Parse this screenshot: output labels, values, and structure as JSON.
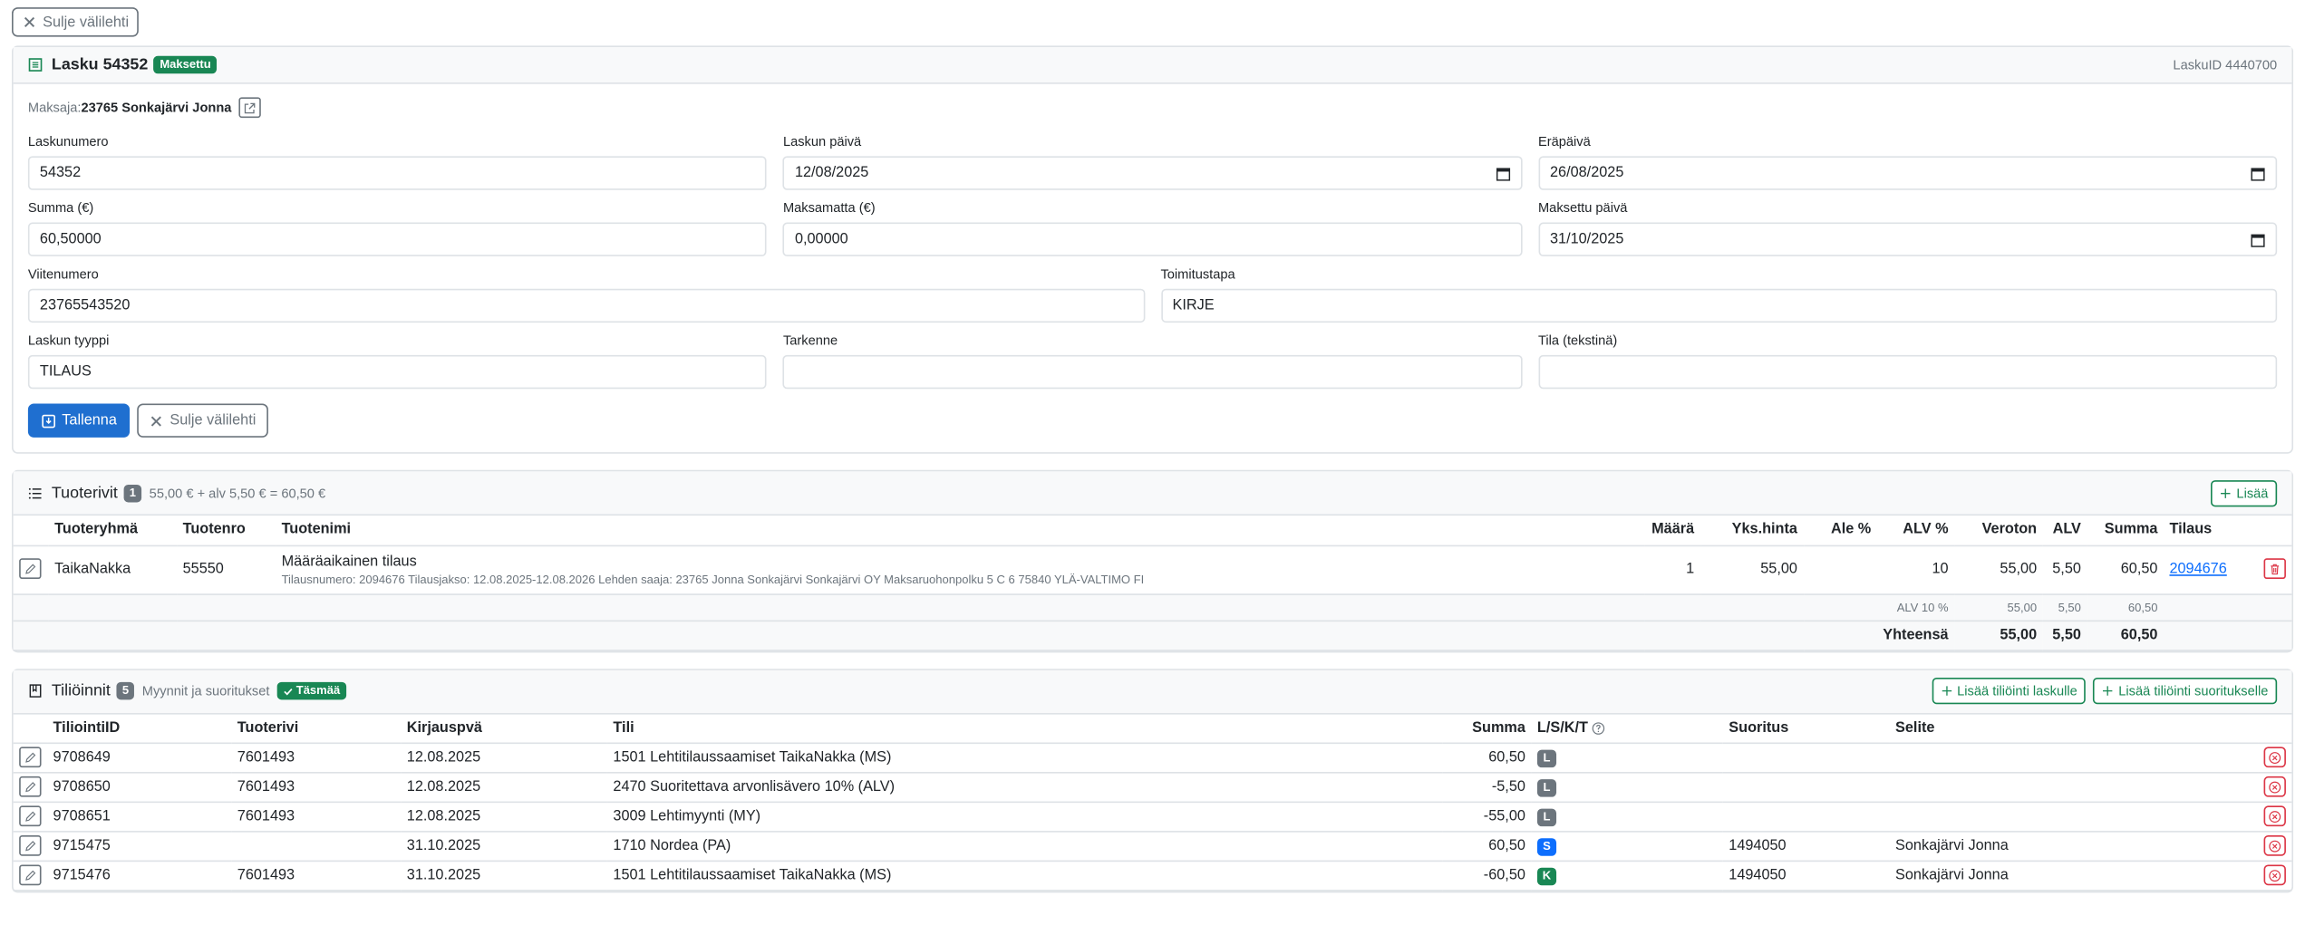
{
  "top": {
    "close_tab_label": "Sulje välilehti"
  },
  "invoice": {
    "title": "Lasku 54352",
    "status_badge": "Maksettu",
    "lasku_id": "LaskuID 4440700",
    "payer_label": "Maksaja:",
    "payer_value": "23765 Sonkajärvi Jonna",
    "fields": {
      "laskunumero": {
        "label": "Laskunumero",
        "value": "54352"
      },
      "laskun_paiva": {
        "label": "Laskun päivä",
        "value": "12/08/2025"
      },
      "erapaiva": {
        "label": "Eräpäivä",
        "value": "26/08/2025"
      },
      "summa": {
        "label": "Summa (€)",
        "value": "60,50000"
      },
      "maksamatta": {
        "label": "Maksamatta (€)",
        "value": "0,00000"
      },
      "maksettu_paiva": {
        "label": "Maksettu päivä",
        "value": "31/10/2025"
      },
      "viitenumero": {
        "label": "Viitenumero",
        "value": "23765543520"
      },
      "toimitustapa": {
        "label": "Toimitustapa",
        "value": "KIRJE"
      },
      "laskun_tyyppi": {
        "label": "Laskun tyyppi",
        "value": "TILAUS"
      },
      "tarkenne": {
        "label": "Tarkenne",
        "value": ""
      },
      "tila": {
        "label": "Tila (tekstinä)",
        "value": ""
      }
    },
    "save_label": "Tallenna",
    "close_label": "Sulje välilehti"
  },
  "products": {
    "title": "Tuoterivit",
    "count": "1",
    "summary": "55,00 € + alv 5,50 € = 60,50 €",
    "add_label": "Lisää",
    "headers": {
      "group": "Tuoteryhmä",
      "number": "Tuotenro",
      "name": "Tuotenimi",
      "qty": "Määrä",
      "unit_price": "Yks.hinta",
      "discount": "Ale %",
      "vat_pct": "ALV %",
      "net": "Veroton",
      "vat": "ALV",
      "sum": "Summa",
      "order": "Tilaus"
    },
    "row": {
      "group": "TaikaNakka",
      "number": "55550",
      "name": "Määräaikainen tilaus",
      "desc": "Tilausnumero: 2094676 Tilausjakso: 12.08.2025-12.08.2026 Lehden saaja: 23765 Jonna Sonkajärvi Sonkajärvi OY Maksaruohonpolku 5 C 6 75840 YLÄ-VALTIMO FI",
      "qty": "1",
      "unit_price": "55,00",
      "discount": "",
      "vat_pct": "10",
      "net": "55,00",
      "vat": "5,50",
      "sum": "60,50",
      "order": "2094676"
    },
    "vat_row": {
      "label": "ALV 10 %",
      "net": "55,00",
      "vat": "5,50",
      "sum": "60,50"
    },
    "total_row": {
      "label": "Yhteensä",
      "net": "55,00",
      "vat": "5,50",
      "sum": "60,50"
    }
  },
  "postings": {
    "title": "Tiliöinnit",
    "count": "5",
    "subtitle": "Myynnit ja suoritukset",
    "match_badge": "Täsmää",
    "add_invoice_label": "Lisää tiliöinti laskulle",
    "add_payment_label": "Lisää tiliöinti suoritukselle",
    "headers": {
      "id": "TiliointiID",
      "product_row": "Tuoterivi",
      "date": "Kirjauspvä",
      "account": "Tili",
      "sum": "Summa",
      "lskt": "L/S/K/T",
      "payment": "Suoritus",
      "desc": "Selite"
    },
    "rows": [
      {
        "id": "9708649",
        "product_row": "7601493",
        "date": "12.08.2025",
        "account": "1501 Lehtitilaussaamiset TaikaNakka (MS)",
        "sum": "60,50",
        "type": "L",
        "type_color": "#6c757d",
        "payment": "",
        "desc": ""
      },
      {
        "id": "9708650",
        "product_row": "7601493",
        "date": "12.08.2025",
        "account": "2470 Suoritettava arvonlisävero 10% (ALV)",
        "sum": "-5,50",
        "type": "L",
        "type_color": "#6c757d",
        "payment": "",
        "desc": ""
      },
      {
        "id": "9708651",
        "product_row": "7601493",
        "date": "12.08.2025",
        "account": "3009 Lehtimyynti (MY)",
        "sum": "-55,00",
        "type": "L",
        "type_color": "#6c757d",
        "payment": "",
        "desc": ""
      },
      {
        "id": "9715475",
        "product_row": "",
        "date": "31.10.2025",
        "account": "1710 Nordea (PA)",
        "sum": "60,50",
        "type": "S",
        "type_color": "#0d6efd",
        "payment": "1494050",
        "desc": "Sonkajärvi Jonna"
      },
      {
        "id": "9715476",
        "product_row": "7601493",
        "date": "31.10.2025",
        "account": "1501 Lehtitilaussaamiset TaikaNakka (MS)",
        "sum": "-60,50",
        "type": "K",
        "type_color": "#198754",
        "payment": "1494050",
        "desc": "Sonkajärvi Jonna"
      }
    ]
  },
  "icons": {
    "close": "x-icon",
    "invoice": "receipt-icon",
    "external": "external-link-icon",
    "calendar": "calendar-icon",
    "save": "save-icon",
    "list": "list-icon",
    "plus": "plus-icon",
    "edit": "pencil-icon",
    "delete": "trash-icon",
    "remove": "x-circle-icon",
    "journal": "journal-icon",
    "check": "check-icon",
    "help": "question-circle-icon"
  }
}
